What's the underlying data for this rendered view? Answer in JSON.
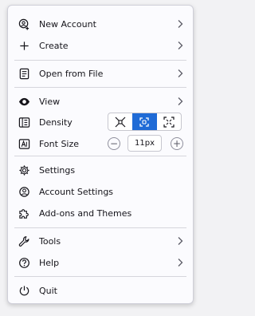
{
  "menu": {
    "new_account": "New Account",
    "create": "Create",
    "open_from_file": "Open from File",
    "view": "View",
    "density": "Density",
    "font_size": "Font Size",
    "font_size_value": "11px",
    "settings": "Settings",
    "account_settings": "Account Settings",
    "addons_themes": "Add-ons and Themes",
    "tools": "Tools",
    "help": "Help",
    "quit": "Quit",
    "zoom_minus": "−",
    "zoom_plus": "+"
  },
  "density_options": [
    "compact",
    "normal",
    "touch"
  ],
  "density_selected": "normal",
  "colors": {
    "accent": "#1f6bd6",
    "menu_bg": "#fbfbfe",
    "text": "#15141a"
  },
  "icons": [
    "new-account-icon",
    "plus-icon",
    "open-file-icon",
    "eye-icon",
    "density-icon",
    "font-size-icon",
    "gear-icon",
    "account-settings-icon",
    "puzzle-icon",
    "wrench-icon",
    "help-icon",
    "power-icon",
    "chevron-right-icon"
  ]
}
